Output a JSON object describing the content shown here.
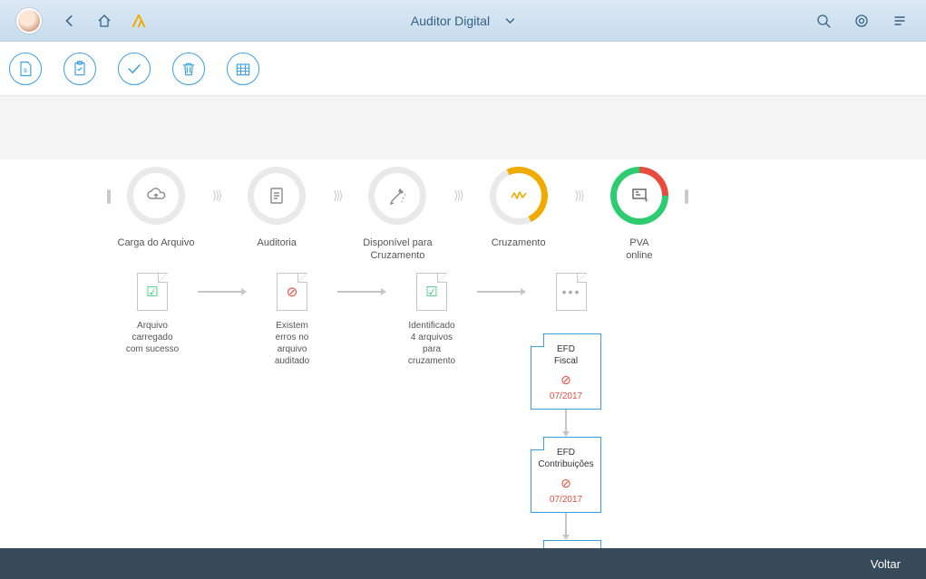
{
  "header": {
    "title": "Auditor Digital"
  },
  "toolbar": {
    "buttons": [
      "document-dollar",
      "clipboard",
      "check",
      "trash",
      "calendar-grid"
    ]
  },
  "stages": [
    {
      "label": "Carga do Arquivo",
      "icon": "cloud",
      "ring": "gray"
    },
    {
      "label": "Auditoria",
      "icon": "doc-lines",
      "ring": "gray"
    },
    {
      "label": "Disponível para\nCruzamento",
      "icon": "wand",
      "ring": "gray"
    },
    {
      "label": "Cruzamento",
      "icon": "zigzag",
      "ring": "orange"
    },
    {
      "label": "PVA\nonline",
      "icon": "pva",
      "ring": "green-red"
    }
  ],
  "substeps": [
    {
      "status": "green",
      "lines": [
        "Arquivo",
        "carregado",
        "com sucesso"
      ]
    },
    {
      "status": "red",
      "lines": [
        "Existem",
        "erros no",
        "arquivo",
        "auditado"
      ]
    },
    {
      "status": "green",
      "lines": [
        "Identificado",
        "4 arquivos",
        "para",
        "cruzamento"
      ]
    },
    {
      "status": "dots",
      "lines": []
    }
  ],
  "cards": [
    {
      "title": "EFD\nFiscal",
      "date": "07/2017"
    },
    {
      "title": "EFD\nContribuições",
      "date": "07/2017"
    }
  ],
  "footer": {
    "back": "Voltar"
  }
}
